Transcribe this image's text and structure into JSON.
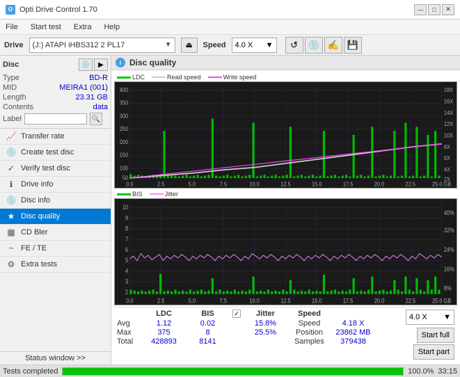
{
  "app": {
    "title": "Opti Drive Control 1.70",
    "icon": "O"
  },
  "titlebar": {
    "minimize": "—",
    "maximize": "□",
    "close": "✕"
  },
  "menubar": {
    "items": [
      "File",
      "Start test",
      "Extra",
      "Help"
    ]
  },
  "drivebar": {
    "drive_label": "Drive",
    "drive_value": "(J:)  ATAPI iHBS312  2 PL17",
    "speed_label": "Speed",
    "speed_value": "4.0 X"
  },
  "disc": {
    "title": "Disc",
    "type_label": "Type",
    "type_value": "BD-R",
    "mid_label": "MID",
    "mid_value": "MEIRA1 (001)",
    "length_label": "Length",
    "length_value": "23.31 GB",
    "contents_label": "Contents",
    "contents_value": "data",
    "label_label": "Label",
    "label_value": ""
  },
  "nav": {
    "items": [
      {
        "id": "transfer-rate",
        "label": "Transfer rate",
        "icon": "📈"
      },
      {
        "id": "create-test-disc",
        "label": "Create test disc",
        "icon": "💿"
      },
      {
        "id": "verify-test-disc",
        "label": "Verify test disc",
        "icon": "✓"
      },
      {
        "id": "drive-info",
        "label": "Drive info",
        "icon": "ℹ"
      },
      {
        "id": "disc-info",
        "label": "Disc info",
        "icon": "💿"
      },
      {
        "id": "disc-quality",
        "label": "Disc quality",
        "icon": "★",
        "active": true
      },
      {
        "id": "cd-bler",
        "label": "CD Bler",
        "icon": "▦"
      },
      {
        "id": "fe-te",
        "label": "FE / TE",
        "icon": "~"
      },
      {
        "id": "extra-tests",
        "label": "Extra tests",
        "icon": "⚙"
      }
    ]
  },
  "status_window": "Status window >>",
  "disc_quality": {
    "title": "Disc quality",
    "chart1": {
      "legend": [
        "LDC",
        "Read speed",
        "Write speed"
      ],
      "y_labels_left": [
        "400",
        "350",
        "300",
        "250",
        "200",
        "150",
        "100",
        "50"
      ],
      "y_labels_right": [
        "18X",
        "16X",
        "14X",
        "12X",
        "10X",
        "8X",
        "6X",
        "4X",
        "2X"
      ],
      "x_labels": [
        "0.0",
        "2.5",
        "5.0",
        "7.5",
        "10.0",
        "12.5",
        "15.0",
        "17.5",
        "20.0",
        "22.5",
        "25.0 GB"
      ]
    },
    "chart2": {
      "legend": [
        "BIS",
        "Jitter"
      ],
      "y_labels_left": [
        "10",
        "9",
        "8",
        "7",
        "6",
        "5",
        "4",
        "3",
        "2",
        "1"
      ],
      "y_labels_right": [
        "40%",
        "32%",
        "24%",
        "16%",
        "8%"
      ],
      "x_labels": [
        "0.0",
        "2.5",
        "5.0",
        "7.5",
        "10.0",
        "12.5",
        "15.0",
        "17.5",
        "20.0",
        "22.5",
        "25.0 GB"
      ]
    }
  },
  "stats": {
    "headers": [
      "LDC",
      "BIS",
      "",
      "Jitter",
      "Speed",
      ""
    ],
    "avg_label": "Avg",
    "avg_ldc": "1.12",
    "avg_bis": "0.02",
    "avg_jitter": "15.8%",
    "max_label": "Max",
    "max_ldc": "375",
    "max_bis": "8",
    "max_jitter": "25.5%",
    "total_label": "Total",
    "total_ldc": "428893",
    "total_bis": "8141",
    "speed_label": "Speed",
    "speed_value": "4.18 X",
    "speed_select": "4.0 X",
    "position_label": "Position",
    "position_value": "23862 MB",
    "samples_label": "Samples",
    "samples_value": "379438",
    "jitter_checked": true,
    "jitter_label": "Jitter"
  },
  "buttons": {
    "start_full": "Start full",
    "start_part": "Start part"
  },
  "progress": {
    "status": "Tests completed",
    "percent": 100,
    "time": "33:15"
  }
}
